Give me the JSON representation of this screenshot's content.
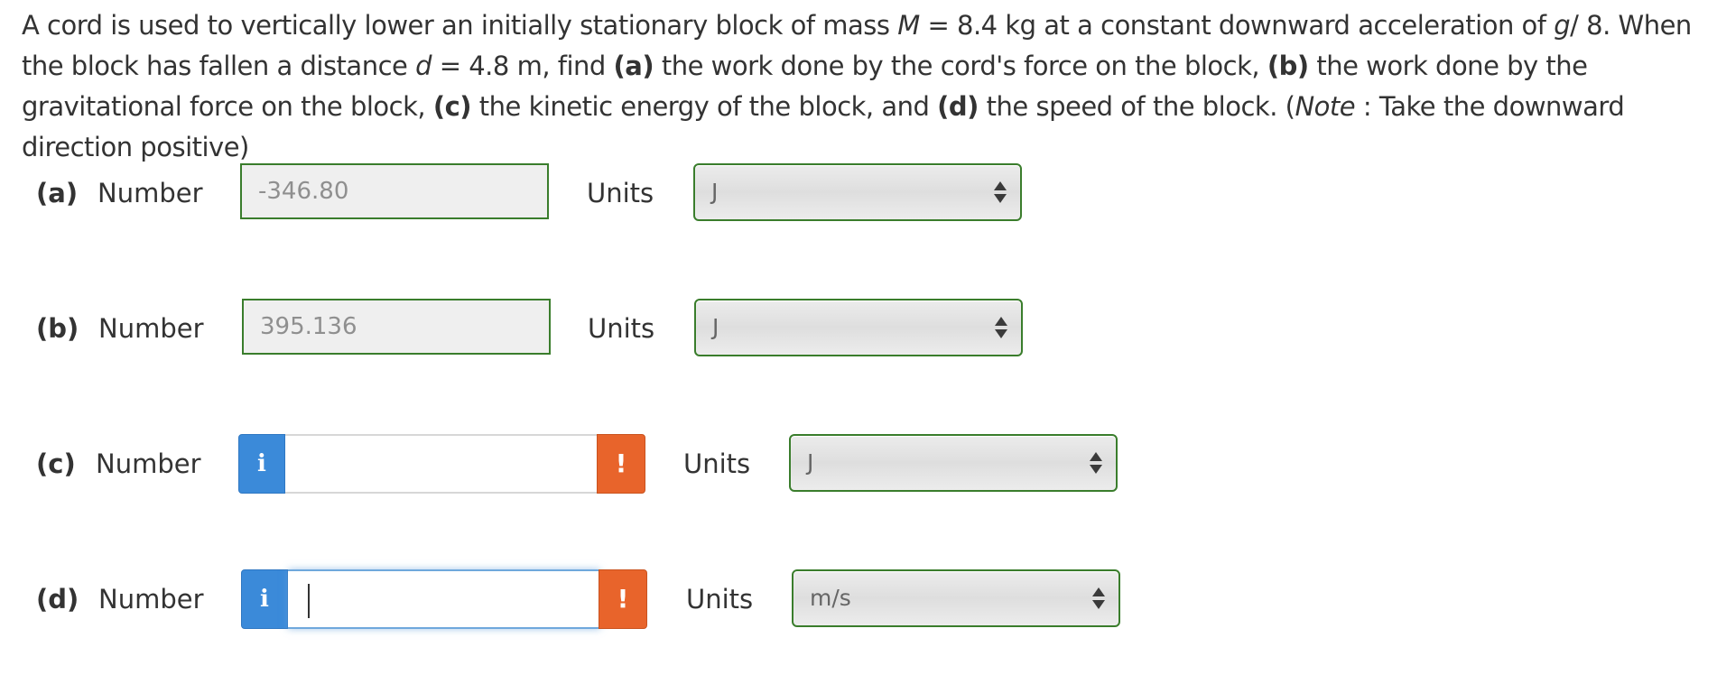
{
  "question": {
    "s1": "A cord is used to vertically lower an initially stationary block of mass ",
    "m_var": "M",
    "s2": " = 8.4 kg at a constant downward acceleration of ",
    "g_var": "g",
    "s3": "/ 8. When the block has fallen a distance ",
    "d_var": "d",
    "s4": " = 4.8 m, find ",
    "a_tag": "(a)",
    "s5": " the work done by the cord's force on the block, ",
    "b_tag": "(b)",
    "s6": " the work done by the gravitational force on the block, ",
    "c_tag": "(c)",
    "s7": " the kinetic energy of the block, and ",
    "d_tag": "(d)",
    "s8": " the speed of the block. (",
    "note_word": "Note",
    "s9": " : Take the downward direction positive)"
  },
  "parts": [
    {
      "label": "(a)",
      "number_label": "Number",
      "value": "-346.80",
      "units_label": "Units",
      "unit": "J"
    },
    {
      "label": "(b)",
      "number_label": "Number",
      "value": "395.136",
      "units_label": "Units",
      "unit": "J"
    },
    {
      "label": "(c)",
      "number_label": "Number",
      "value": "",
      "units_label": "Units",
      "unit": "J",
      "info_icon": "i",
      "warning_icon": "!"
    },
    {
      "label": "(d)",
      "number_label": "Number",
      "value": "",
      "units_label": "Units",
      "unit": "m/s",
      "info_icon": "i",
      "warning_icon": "!"
    }
  ],
  "colors": {
    "correct_border": "#3a7d2c",
    "info_blue": "#3b8ad9",
    "warning_orange": "#e8642b",
    "focus_glow": "#6fa8dc"
  }
}
